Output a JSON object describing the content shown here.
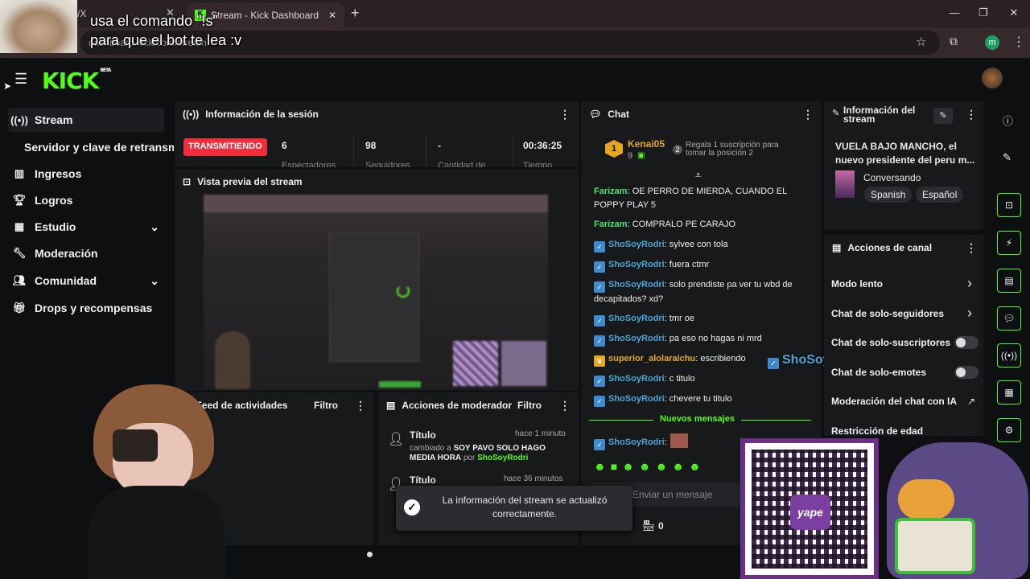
{
  "browser": {
    "tab_title": "Stream - Kick Dashboard",
    "address": "dashboard.kick.com/stream",
    "profile_initial": "m",
    "prev_tab_fragment": "/X"
  },
  "overlay": {
    "line1": "usa el comando \"!s\"",
    "line2": "para que el bot te lea :v"
  },
  "app": {
    "logo": "KICK",
    "logo_badge": "BETA"
  },
  "sidebar": {
    "items": [
      {
        "label": "Stream",
        "icon": "broadcast-icon"
      },
      {
        "label": "Servidor y clave de retransm"
      },
      {
        "label": "Ingresos",
        "icon": "bank-icon"
      },
      {
        "label": "Logros",
        "icon": "trophy-icon"
      },
      {
        "label": "Estudio",
        "icon": "grid-icon"
      },
      {
        "label": "Moderación",
        "icon": "wrench-icon"
      },
      {
        "label": "Comunidad",
        "icon": "users-icon"
      },
      {
        "label": "Drops y recompensas",
        "icon": "gift-icon"
      }
    ]
  },
  "session": {
    "title": "Información de la sesión",
    "status": "TRANSMITIENDO",
    "viewers": "6",
    "viewers_label": "Espectadores",
    "followers": "98",
    "followers_label": "Seguidores",
    "subs": "-",
    "subs_label": "Cantidad de",
    "time": "00:36:25",
    "time_label": "Tiempo"
  },
  "preview": {
    "title": "Vista previa del stream"
  },
  "activity": {
    "title": "Feed de actividades",
    "filter": "Filtro"
  },
  "modactions": {
    "title": "Acciones de moderador",
    "filter": "Filtro",
    "items": [
      {
        "title": "Título",
        "time": "hace 1 minuto",
        "desc_pre": "cambiado a",
        "desc_val": "SOY PAVO SOLO HAGO MEDIA HORA",
        "desc_by": "por",
        "user": "ShoSoyRodri"
      },
      {
        "title": "Título",
        "time": "hace 36 minutos"
      }
    ]
  },
  "toast": {
    "line1": "La información del stream se actualizó",
    "line2": "correctamente."
  },
  "chat": {
    "title": "Chat",
    "pinned_user": "Kenai05",
    "pinned_count": "9",
    "pinned_rank": "1",
    "pinned_rank2": "2",
    "pinned_hint": "Regala 1 suscripción para tomar la posición 2",
    "messages": [
      {
        "user": "Farizam",
        "text": "OE PERRO DE MIERDA, CUANDO EL POPPY PLAY 5"
      },
      {
        "user": "Farizam",
        "text": "COMPRALO PE CARAJO"
      },
      {
        "user": "ShoSoyRodri",
        "text": "sylvee con tola"
      },
      {
        "user": "ShoSoyRodri",
        "text": "fuera ctmr"
      },
      {
        "user": "ShoSoyRodri",
        "text": "solo prendiste pa ver tu wbd de decapitados? xd?"
      },
      {
        "user": "ShoSoyRodri",
        "text": "tmr oe"
      },
      {
        "user": "ShoSoyRodri",
        "text": "pa eso no hagas ni mrd"
      },
      {
        "user": "superior_alolaraichu",
        "text": "escribiendo"
      },
      {
        "user": "ShoSoyRodri",
        "text": "c titulo"
      },
      {
        "user": "ShoSoyRodri",
        "text": "chevere tu titulo"
      }
    ],
    "new_messages": "Nuevos mensajes",
    "last_user": "ShoSoyRodri",
    "input_placeholder": "Enviar un mensaje",
    "points": "0",
    "floating_name": "ShoSoyRodri :"
  },
  "streaminfo": {
    "title": "Información del stream",
    "stream_title": "VUELA BAJO MANCHO, el nuevo presidente del peru m...",
    "category": "Conversando",
    "tags": [
      "Spanish",
      "Español"
    ]
  },
  "channel": {
    "title": "Acciones de canal",
    "items": [
      {
        "label": "Modo lento",
        "type": "arrow"
      },
      {
        "label": "Chat de solo-seguidores",
        "type": "arrow"
      },
      {
        "label": "Chat de solo-suscriptores",
        "type": "toggle"
      },
      {
        "label": "Chat de solo-emotes",
        "type": "toggle"
      },
      {
        "label": "Moderación del chat con IA",
        "type": "link"
      },
      {
        "label": "Restricción de edad",
        "type": "arrow"
      }
    ]
  },
  "qr": {
    "brand": "yape"
  }
}
